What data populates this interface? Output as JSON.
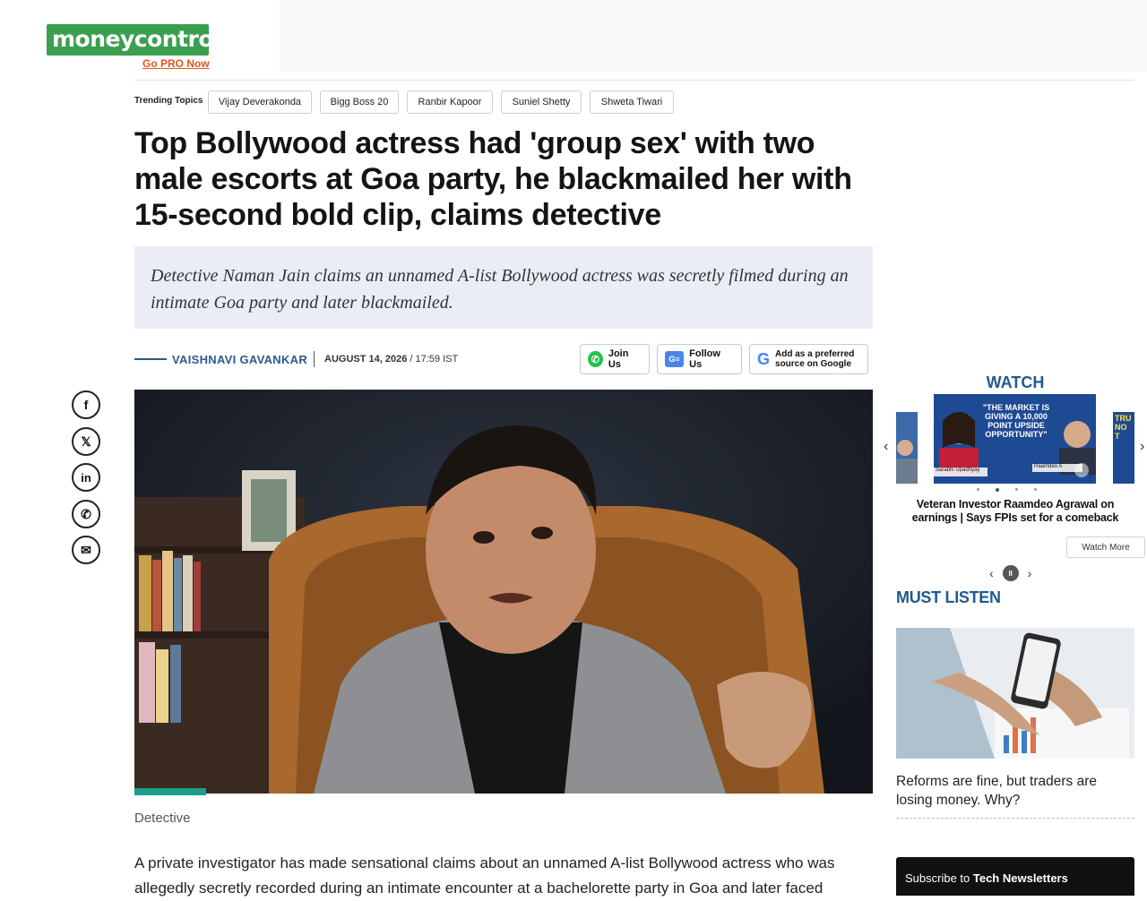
{
  "header": {
    "logo_money": "money",
    "logo_control": "control",
    "go_pro": "Go PRO Now"
  },
  "trending": {
    "label": "Trending Topics",
    "topics": [
      "Vijay Deverakonda",
      "Bigg Boss 20",
      "Ranbir Kapoor",
      "Suniel Shetty",
      "Shweta Tiwari"
    ]
  },
  "article": {
    "headline": "Top Bollywood actress had 'group sex' with two male escorts at Goa party, he blackmailed her with 15-second bold clip, claims detective",
    "summary": "Detective Naman Jain claims an unnamed A-list Bollywood actress was secretly filmed during an intimate Goa party and later blackmailed.",
    "author": "VAISHNAVI GAVANKAR",
    "date": "AUGUST 14, 2026",
    "time": "/ 17:59 IST",
    "caption": "Detective",
    "body_line1": "A private investigator has made sensational claims about an unnamed A-list Bollywood actress who was",
    "body_line2": "allegedly secretly recorded during an intimate encounter at a bachelorette party in Goa and later faced"
  },
  "social_buttons": {
    "join_us": "Join Us",
    "follow_us": "Follow Us",
    "google_pref_line1": "Add as a preferred",
    "google_pref_line2": "source on Google",
    "whatsapp_glyph": "✆",
    "gn_glyph": "G≡",
    "google_glyph": "G"
  },
  "share_icons": {
    "facebook": "f",
    "x": "𝕏",
    "linkedin": "in",
    "whatsapp": "✆",
    "email": "✉"
  },
  "watch": {
    "title": "WATCH",
    "caption": "Veteran Investor Raamdeo Agrawal on earnings | Says FPIs set for a comeback",
    "watch_more": "Watch More",
    "thumb_text": "\"THE MARKET IS GIVING A 10,000 POINT UPSIDE OPPORTUNITY\"",
    "host_name": "Sarabhi Upadhyay",
    "guest_name": "Raamdeo A",
    "side_thumb_text": "TRU NO T",
    "prev_arrow": "‹",
    "next_arrow": "›",
    "pause_glyph": "II"
  },
  "must_listen": {
    "title": "MUST LISTEN",
    "caption": "Reforms are fine, but traders are losing money. Why?"
  },
  "newsletter": {
    "prefix": "Subscribe to ",
    "bold": "Tech Newsletters"
  },
  "colors": {
    "brand_green": "#3a9f4f",
    "accent_blue": "#1f5a8e",
    "teal": "#1a9e8a",
    "summary_bg": "#eaedf5"
  }
}
